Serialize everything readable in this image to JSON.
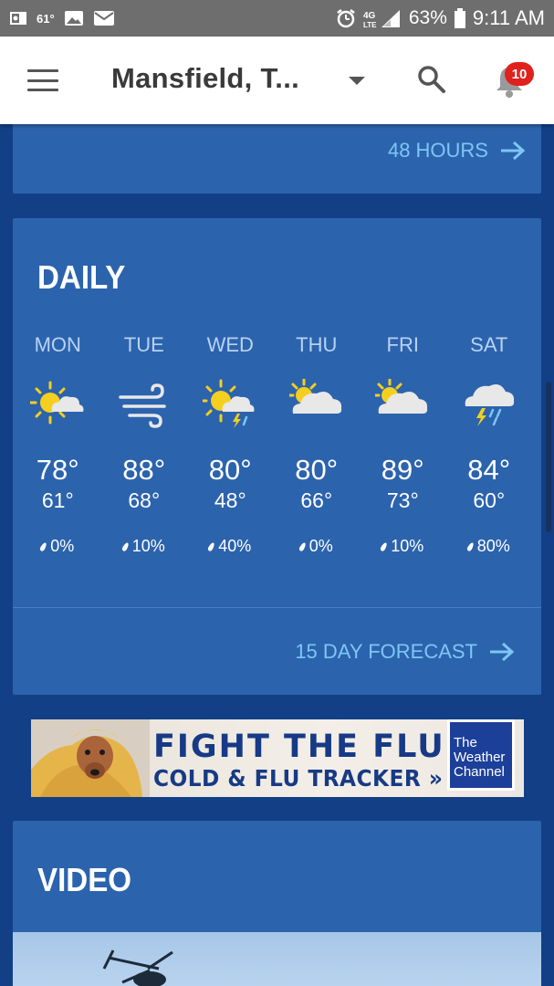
{
  "status_bar": {
    "temperature": "61°",
    "battery_pct": "63%",
    "time": "9:11 AM",
    "network": "4G LTE",
    "icons": [
      "outlook-icon",
      "image-icon",
      "mail-icon",
      "alarm-icon",
      "signal-icon",
      "battery-icon"
    ]
  },
  "app_bar": {
    "location": "Mansfield, T...",
    "notification_count": "10",
    "icons": [
      "menu-icon",
      "dropdown-icon",
      "search-icon",
      "bell-icon"
    ]
  },
  "hourly": {
    "link_label": "48 HOURS"
  },
  "daily": {
    "title": "DAILY",
    "days": [
      {
        "name": "MON",
        "icon": "sun-cloud-icon",
        "high": "78°",
        "low": "61°",
        "precip": "0%"
      },
      {
        "name": "TUE",
        "icon": "wind-icon",
        "high": "88°",
        "low": "68°",
        "precip": "10%"
      },
      {
        "name": "WED",
        "icon": "sun-thunderstorm-icon",
        "high": "80°",
        "low": "48°",
        "precip": "40%"
      },
      {
        "name": "THU",
        "icon": "partly-cloudy-icon",
        "high": "80°",
        "low": "66°",
        "precip": "0%"
      },
      {
        "name": "FRI",
        "icon": "partly-cloudy-icon",
        "high": "89°",
        "low": "73°",
        "precip": "10%"
      },
      {
        "name": "SAT",
        "icon": "thunderstorm-icon",
        "high": "84°",
        "low": "60°",
        "precip": "80%"
      }
    ],
    "link_label": "15 DAY FORECAST"
  },
  "ad": {
    "line1": "FIGHT THE FLU",
    "line2": "COLD & FLU TRACKER",
    "chevrons": "»",
    "brand": [
      "The",
      "Weather",
      "Channel"
    ]
  },
  "video": {
    "title": "VIDEO"
  },
  "colors": {
    "background": "#123f86",
    "card": "#2c63ad",
    "link": "#7dc6f5",
    "sun": "#f4cf1f",
    "cloud": "#e8e8e8",
    "badge": "#e0211d"
  }
}
